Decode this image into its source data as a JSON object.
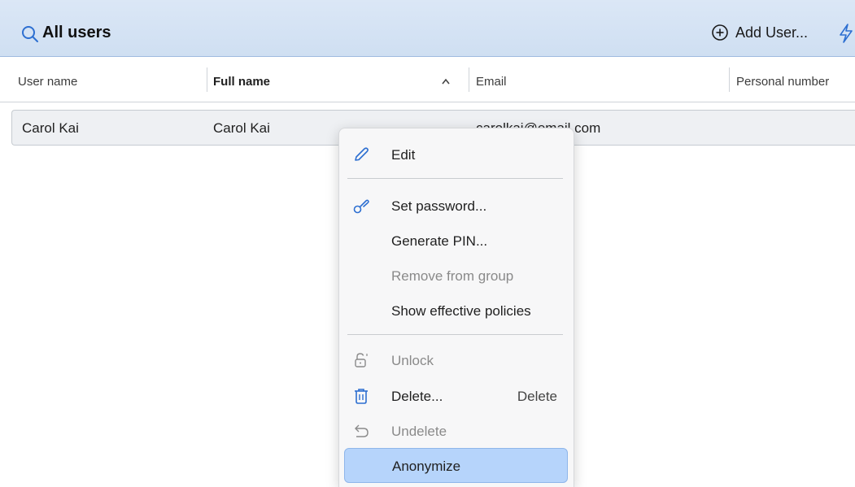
{
  "header": {
    "title": "All users",
    "add_user_label": "Add User...",
    "icons": [
      "search-icon",
      "plus-circle-icon",
      "bolt-icon"
    ]
  },
  "columns": [
    "User name",
    "Full name",
    "Email",
    "Personal number"
  ],
  "rows": [
    {
      "user_name": "Carol Kai",
      "full_name": "Carol Kai",
      "email": "carolkai@email.com"
    }
  ],
  "context_menu": {
    "edit": "Edit",
    "set_password": "Set password...",
    "generate_pin": "Generate PIN...",
    "remove_from_group": "Remove from group",
    "show_effective_policies": "Show effective policies",
    "unlock": "Unlock",
    "delete": "Delete...",
    "delete_shortcut": "Delete",
    "undelete": "Undelete",
    "anonymize": "Anonymize"
  },
  "colors": {
    "header_bg": "#d5e4f5",
    "accent": "#2d6fd1",
    "highlight": "#b6d4fb"
  }
}
